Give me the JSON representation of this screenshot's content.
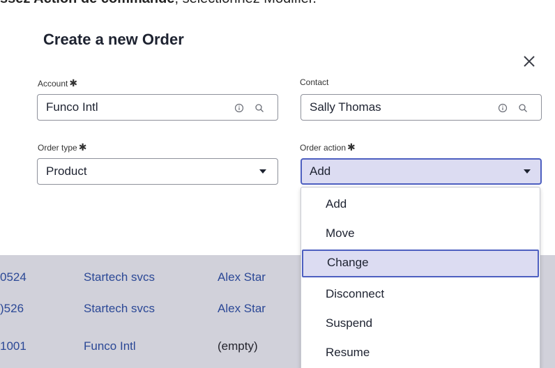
{
  "instruction_text": {
    "bold_text": "ssez Action de commande",
    "rest_text": ", sélectionnez Modifier."
  },
  "modal": {
    "title": "Create a new Order",
    "close_icon": "close-icon",
    "account": {
      "label": "Account",
      "required_mark": "✱",
      "value": "Funco Intl"
    },
    "contact": {
      "label": "Contact",
      "value": "Sally Thomas"
    },
    "order_type": {
      "label": "Order type",
      "required_mark": "✱",
      "value": "Product"
    },
    "order_action": {
      "label": "Order action",
      "required_mark": "✱",
      "value": "Add"
    }
  },
  "dropdown": {
    "options": [
      "Add",
      "Move",
      "Change",
      "Disconnect",
      "Suspend",
      "Resume"
    ],
    "highlighted": "Change"
  },
  "background_list": {
    "rows": [
      {
        "number": "0524",
        "account": "Startech svcs",
        "contact": "Alex Star"
      },
      {
        "number": ")526",
        "account": "Startech svcs",
        "contact": "Alex Star"
      },
      {
        "number": "1001",
        "account": "Funco Intl",
        "contact": "(empty)"
      }
    ]
  },
  "colors": {
    "accent": "#4d5fc0",
    "focus_fill": "#dcdcf2",
    "link": "#2b50a8",
    "overlay": "#2d2f55"
  }
}
